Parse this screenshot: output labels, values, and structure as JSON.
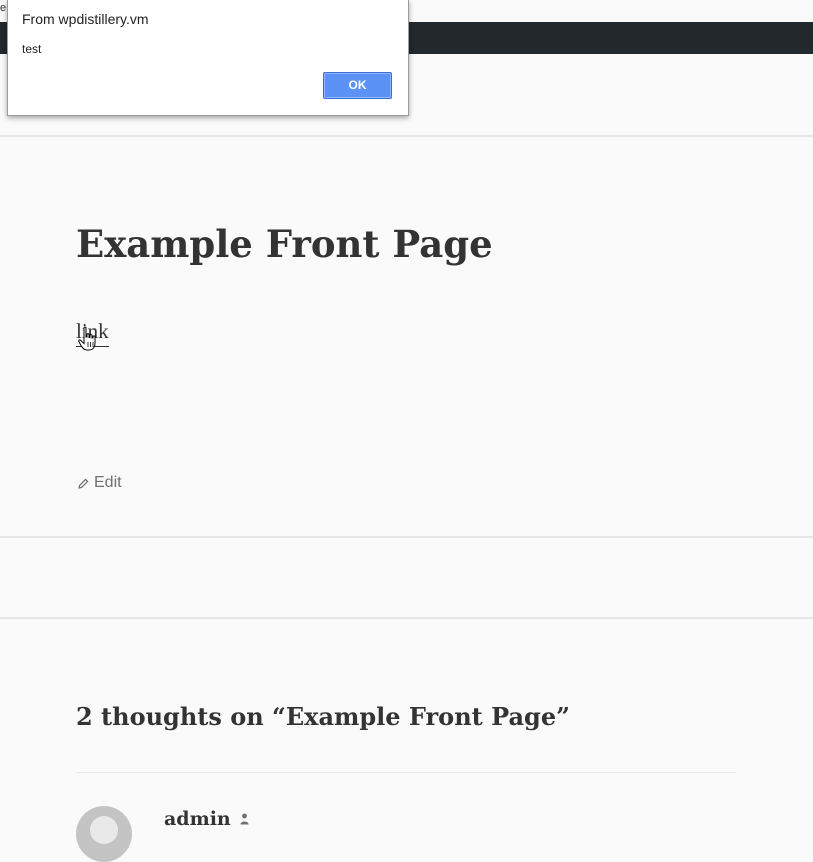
{
  "browser": {
    "edge_text": "e"
  },
  "alert": {
    "title": "From wpdistillery.vm",
    "message": "test",
    "ok_label": "OK",
    "ok_color": "#5a93f5"
  },
  "admin_bar": {
    "color": "#23282d"
  },
  "article": {
    "title": "Example Front Page",
    "link_text": "link",
    "edit_label": "Edit",
    "edit_icon": "pencil-icon"
  },
  "comments": {
    "title": "2 thoughts on “Example Front Page”",
    "first_author": "admin",
    "author_badge_icon": "person-icon"
  },
  "colors": {
    "background": "#fafafa",
    "text": "#333333",
    "meta_text": "#707070",
    "divider": "#e6e6e6"
  }
}
